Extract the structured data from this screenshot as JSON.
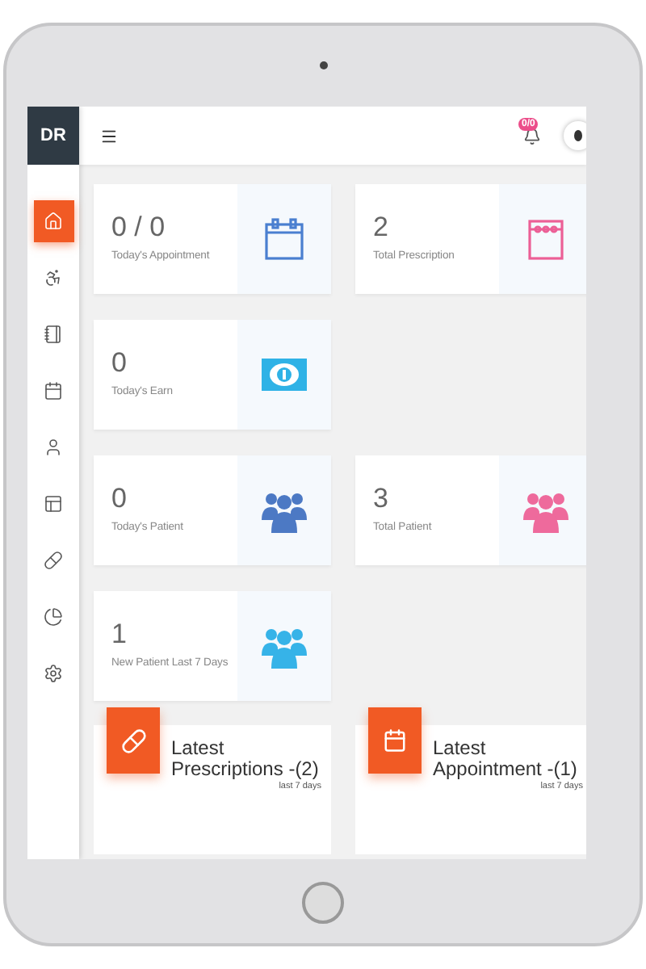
{
  "brand": "DR",
  "sidebar": {
    "items": [
      {
        "kind": "home",
        "selected": true
      },
      {
        "kind": "wheelchair",
        "selected": false
      },
      {
        "kind": "notebook",
        "selected": false
      },
      {
        "kind": "calendar",
        "selected": false
      },
      {
        "kind": "user",
        "selected": false
      },
      {
        "kind": "layout",
        "selected": false
      },
      {
        "kind": "pill",
        "selected": false
      },
      {
        "kind": "chart",
        "selected": false
      },
      {
        "kind": "settings",
        "selected": false
      }
    ]
  },
  "topbar": {
    "notification_badge": "0/0"
  },
  "stat_rows": [
    [
      {
        "value": "0 / 0",
        "label": "Today's Appointment",
        "kind": "calendar",
        "color": "#4a7fd0"
      },
      {
        "value": "2",
        "label": "Total Prescription",
        "kind": "notebook",
        "color": "#ec5f96"
      }
    ],
    [
      {
        "value": "0",
        "label": "Today's Earn",
        "kind": "money",
        "color": "#2fb2e6"
      }
    ],
    [
      {
        "value": "0",
        "label": "Today's Patient",
        "kind": "group",
        "color": "#4c79c4"
      },
      {
        "value": "3",
        "label": "Total Patient",
        "kind": "group",
        "color": "#ee6a9c"
      }
    ],
    [
      {
        "value": "1",
        "label": "New Patient Last 7 Days",
        "kind": "group",
        "color": "#36b3e8"
      }
    ]
  ],
  "panels": [
    {
      "kind": "pill",
      "title": "Latest Prescriptions -(2)",
      "subtitle": "last 7 days"
    },
    {
      "kind": "calendar",
      "title": "Latest Appointment -(1)",
      "subtitle": "last 7 days"
    }
  ]
}
